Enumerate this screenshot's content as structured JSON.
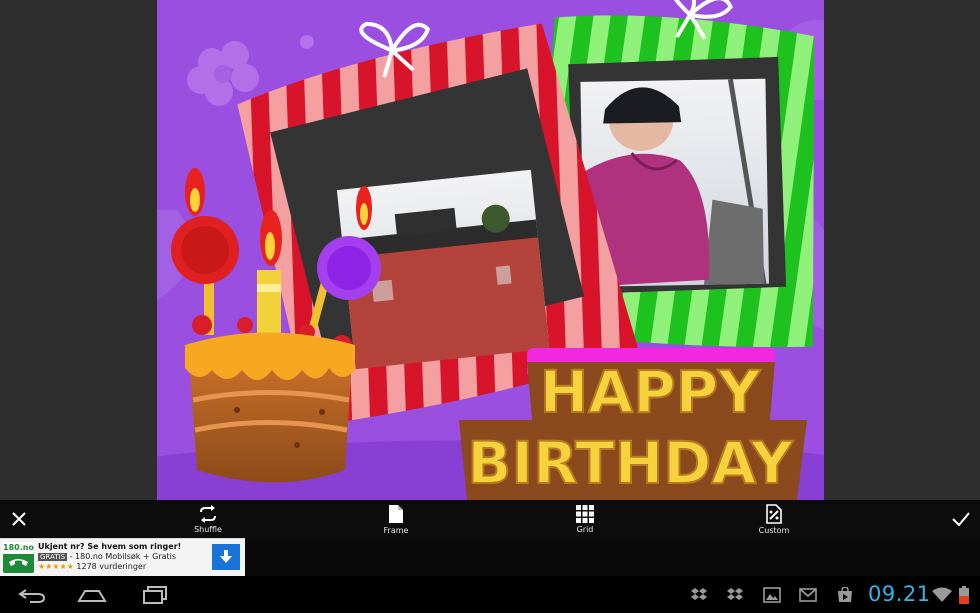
{
  "card": {
    "banner_line1": "HAPPY",
    "banner_line2": "BIRTHDAY"
  },
  "toolbar": {
    "tools": [
      {
        "label": "Shuffle",
        "icon": "shuffle-icon"
      },
      {
        "label": "Frame",
        "icon": "frame-icon"
      },
      {
        "label": "Grid",
        "icon": "grid-icon"
      },
      {
        "label": "Custom",
        "icon": "custom-icon"
      }
    ],
    "close_icon": "close-icon",
    "done_icon": "checkmark-icon"
  },
  "ad": {
    "logo": "180.no",
    "title": "Ukjent nr? Se hvem som ringer!",
    "badge": "GRATIS",
    "subtitle": "- 180.no Mobilsøk + Gratis",
    "stars": "★★★★★",
    "reviews": "1278 vurderinger",
    "download_icon": "download-arrow-icon"
  },
  "status": {
    "time": "09.21"
  },
  "colors": {
    "card_bg": "#9a4fe0",
    "accent_clock": "#33b5e5",
    "toolbar_bg": "#0c0c0c"
  }
}
